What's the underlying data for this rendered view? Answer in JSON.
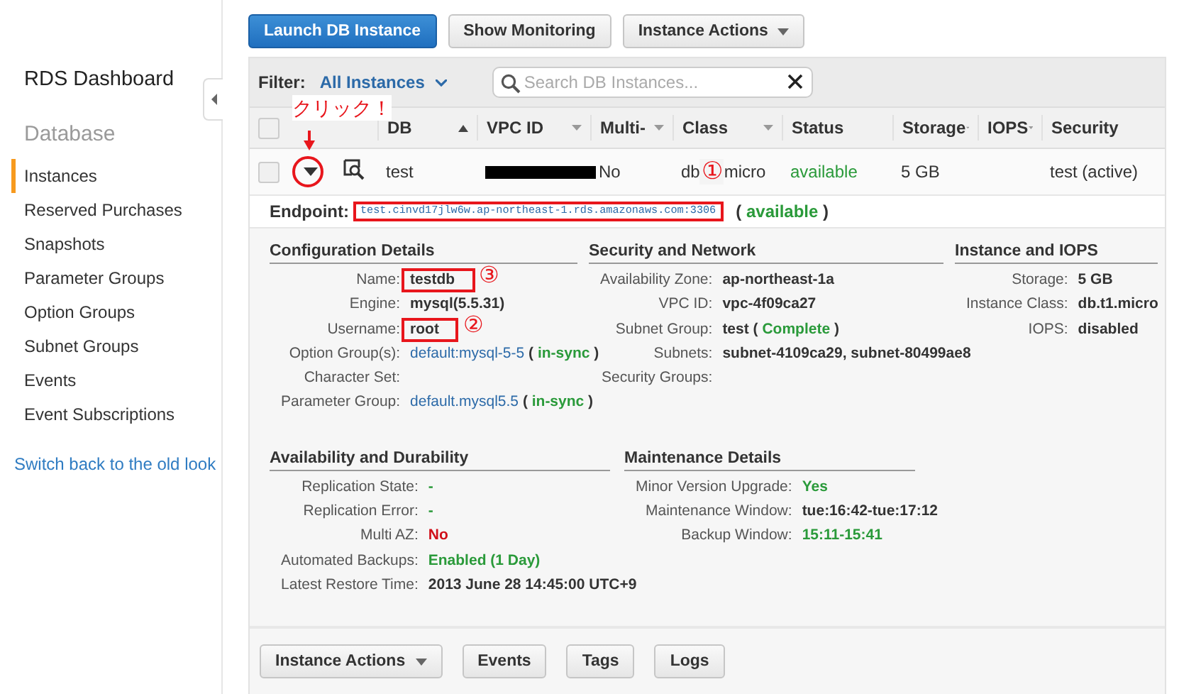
{
  "sidebar": {
    "title": "RDS Dashboard",
    "section": "Database",
    "items": [
      {
        "label": "Instances",
        "selected": true
      },
      {
        "label": "Reserved Purchases",
        "selected": false
      },
      {
        "label": "Snapshots",
        "selected": false
      },
      {
        "label": "Parameter Groups",
        "selected": false
      },
      {
        "label": "Option Groups",
        "selected": false
      },
      {
        "label": "Subnet Groups",
        "selected": false
      },
      {
        "label": "Events",
        "selected": false
      },
      {
        "label": "Event Subscriptions",
        "selected": false
      }
    ],
    "footer_link": "Switch back to the old look"
  },
  "toolbar": {
    "buttons": [
      {
        "label": "Launch DB Instance",
        "kind": "primary"
      },
      {
        "label": "Show Monitoring",
        "kind": "plain"
      },
      {
        "label": "Instance Actions",
        "kind": "menu"
      }
    ]
  },
  "filter": {
    "label": "Filter:",
    "value": "All Instances",
    "search": {
      "placeholder": "Search DB Instances..."
    }
  },
  "table": {
    "all_selected": false,
    "columns": [
      {
        "label": "DB",
        "sorted_ascending": true,
        "has_menu": false
      },
      {
        "label": "VPC ID",
        "sorted_ascending": false,
        "has_menu": true
      },
      {
        "label": "Multi-",
        "sorted_ascending": false,
        "has_menu": true
      },
      {
        "label": "Class",
        "sorted_ascending": false,
        "has_menu": true
      },
      {
        "label": "Status",
        "sorted_ascending": false,
        "has_menu": false
      },
      {
        "label": "Storage",
        "sorted_ascending": false,
        "has_menu": true
      },
      {
        "label": "IOPS",
        "sorted_ascending": false,
        "has_menu": true
      },
      {
        "label": "Security",
        "sorted_ascending": false,
        "has_menu": false
      }
    ],
    "rows": [
      {
        "selected": false,
        "expanded": true,
        "callout": "クリック！",
        "db": "test",
        "vpc_id_redacted": true,
        "multi_az": "No",
        "class": {
          "parts": [
            "db",
            "micro"
          ],
          "marker": "①"
        },
        "status": "available",
        "storage": "5 GB",
        "security": "test (active)"
      }
    ]
  },
  "endpoint": {
    "label": "Endpoint:",
    "address": "test.cinvd17jlw6w.ap-northeast-1.rds.amazonaws.com:3306",
    "highlight": true,
    "status": [
      {
        "text": "(",
        "kind": "bold"
      },
      {
        "text": "available",
        "kind": "ok"
      },
      {
        "text": ")",
        "kind": "bold"
      }
    ]
  },
  "details": [
    {
      "title": "Configuration Details",
      "fields": [
        {
          "label": "Name:",
          "value": [
            {
              "text": "testdb",
              "kind": "bold"
            }
          ],
          "highlight": true,
          "marker": "③"
        },
        {
          "label": "Engine:",
          "value": [
            {
              "text": "mysql(5.5.31)",
              "kind": "bold"
            }
          ]
        },
        {
          "label": "Username:",
          "value": [
            {
              "text": "root",
              "kind": "bold"
            }
          ],
          "highlight": true,
          "marker": "②"
        },
        {
          "label": "Option Group(s):",
          "value": [
            {
              "text": "default:mysql-5-5",
              "kind": "link"
            },
            {
              "text": "(",
              "kind": "bold"
            },
            {
              "text": "in-sync",
              "kind": "ok"
            },
            {
              "text": ")",
              "kind": "bold"
            }
          ]
        },
        {
          "label": "Character Set:"
        },
        {
          "label": "Parameter Group:",
          "value": [
            {
              "text": "default.mysql5.5",
              "kind": "link"
            },
            {
              "text": "(",
              "kind": "bold"
            },
            {
              "text": "in-sync",
              "kind": "ok"
            },
            {
              "text": ")",
              "kind": "bold"
            }
          ]
        }
      ]
    },
    {
      "title": "Security and Network",
      "fields": [
        {
          "label": "Availability Zone:",
          "value": [
            {
              "text": "ap-northeast-1a",
              "kind": "bold"
            }
          ]
        },
        {
          "label": "VPC ID:",
          "value": [
            {
              "text": "vpc-4f09ca27",
              "kind": "bold"
            }
          ]
        },
        {
          "label": "Subnet Group:",
          "value": [
            {
              "text": "test",
              "kind": "bold"
            },
            {
              "text": "(",
              "kind": "bold"
            },
            {
              "text": "Complete",
              "kind": "ok"
            },
            {
              "text": ")",
              "kind": "bold"
            }
          ]
        },
        {
          "label": "Subnets:",
          "value": [
            {
              "text": "subnet-4109ca29, subnet-80499ae8",
              "kind": "bold"
            }
          ]
        },
        {
          "label": "Security Groups:"
        }
      ]
    },
    {
      "title": "Instance and IOPS",
      "fields": [
        {
          "label": "Storage:",
          "value": [
            {
              "text": "5 GB",
              "kind": "bold"
            }
          ]
        },
        {
          "label": "Instance Class:",
          "value": [
            {
              "text": "db.t1.micro",
              "kind": "bold"
            }
          ]
        },
        {
          "label": "IOPS:",
          "value": [
            {
              "text": "disabled",
              "kind": "bold"
            }
          ]
        }
      ]
    },
    {
      "title": "Availability and Durability",
      "fields": [
        {
          "label": "Replication State:",
          "value": [
            {
              "text": "-",
              "kind": "ok"
            }
          ]
        },
        {
          "label": "Replication Error:",
          "value": [
            {
              "text": "-",
              "kind": "ok"
            }
          ]
        },
        {
          "label": "Multi AZ:",
          "value": [
            {
              "text": "No",
              "kind": "err"
            }
          ]
        },
        {
          "label": "Automated Backups:",
          "value": [
            {
              "text": "Enabled (1 Day)",
              "kind": "ok"
            }
          ]
        },
        {
          "label": "Latest Restore Time:",
          "value": [
            {
              "text": "2013 June 28 14:45:00 UTC+9",
              "kind": "bold"
            }
          ]
        }
      ]
    },
    {
      "title": "Maintenance Details",
      "fields": [
        {
          "label": "Minor Version Upgrade:",
          "value": [
            {
              "text": "Yes",
              "kind": "ok"
            }
          ]
        },
        {
          "label": "Maintenance Window:",
          "value": [
            {
              "text": "tue:16:42-tue:17:12",
              "kind": "bold"
            }
          ]
        },
        {
          "label": "Backup Window:",
          "value": [
            {
              "text": "15:11-15:41",
              "kind": "ok"
            }
          ]
        }
      ]
    }
  ],
  "actions": [
    {
      "label": "Instance Actions",
      "kind": "menu"
    },
    {
      "label": "Events",
      "kind": "plain"
    },
    {
      "label": "Tags",
      "kind": "plain"
    },
    {
      "label": "Logs",
      "kind": "plain"
    }
  ]
}
